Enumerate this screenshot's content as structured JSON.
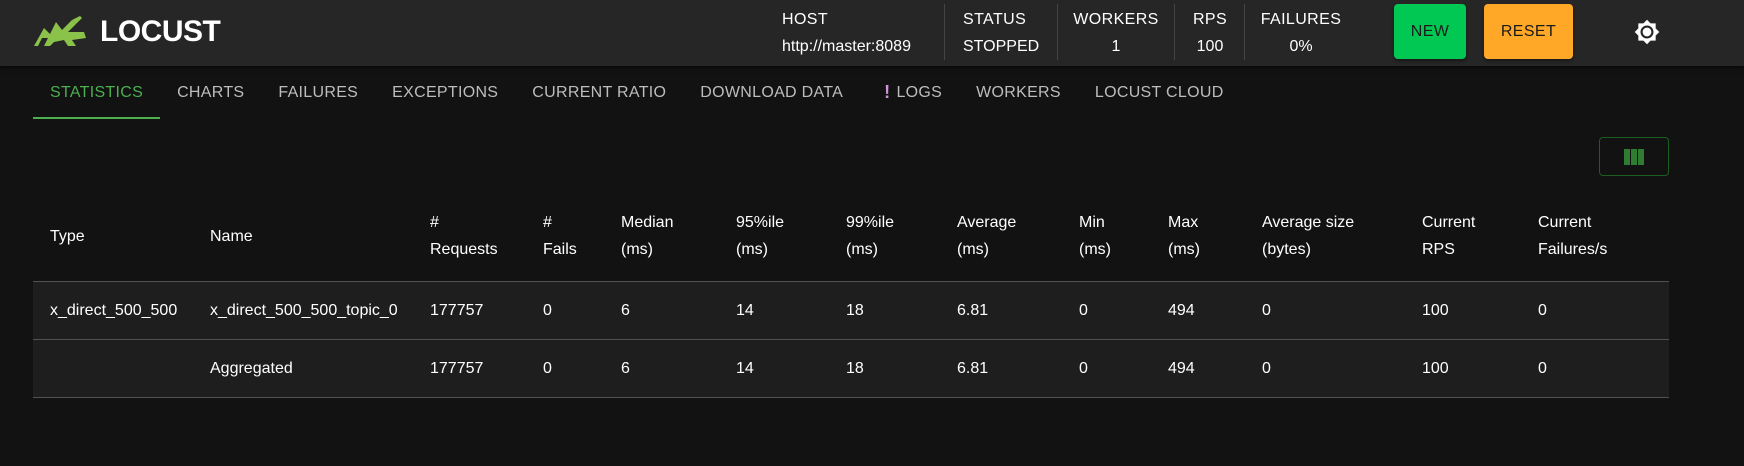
{
  "app": {
    "brand": "LOCUST"
  },
  "header": {
    "host_label": "HOST",
    "host_value": "http://master:8089",
    "status_label": "STATUS",
    "status_value": "STOPPED",
    "workers_label": "WORKERS",
    "workers_value": "1",
    "rps_label": "RPS",
    "rps_value": "100",
    "failures_label": "FAILURES",
    "failures_value": "0%",
    "new_label": "NEW",
    "reset_label": "RESET",
    "theme_icon": "sun-icon",
    "colors": {
      "new": "#00c853",
      "reset": "#ffa726",
      "accent": "#4caf50"
    }
  },
  "tabs": [
    {
      "label": "STATISTICS",
      "active": true
    },
    {
      "label": "CHARTS"
    },
    {
      "label": "FAILURES"
    },
    {
      "label": "EXCEPTIONS"
    },
    {
      "label": "CURRENT RATIO"
    },
    {
      "label": "DOWNLOAD DATA"
    },
    {
      "label": "LOGS",
      "icon": "!"
    },
    {
      "label": "WORKERS"
    },
    {
      "label": "LOCUST CLOUD"
    }
  ],
  "columns_button_icon": "view-columns-icon",
  "table": {
    "headers": [
      [
        "Type"
      ],
      [
        "Name"
      ],
      [
        "#",
        "Requests"
      ],
      [
        "#",
        "Fails"
      ],
      [
        "Median",
        "(ms)"
      ],
      [
        "95%ile",
        "(ms)"
      ],
      [
        "99%ile",
        "(ms)"
      ],
      [
        "Average",
        "(ms)"
      ],
      [
        "Min",
        "(ms)"
      ],
      [
        "Max",
        "(ms)"
      ],
      [
        "Average size",
        "(bytes)"
      ],
      [
        "Current",
        "RPS"
      ],
      [
        "Current",
        "Failures/s"
      ]
    ],
    "rows": [
      [
        "x_direct_500_500",
        "x_direct_500_500_topic_0",
        "177757",
        "0",
        "6",
        "14",
        "18",
        "6.81",
        "0",
        "494",
        "0",
        "100",
        "0"
      ],
      [
        "",
        "Aggregated",
        "177757",
        "0",
        "6",
        "14",
        "18",
        "6.81",
        "0",
        "494",
        "0",
        "100",
        "0"
      ]
    ]
  }
}
